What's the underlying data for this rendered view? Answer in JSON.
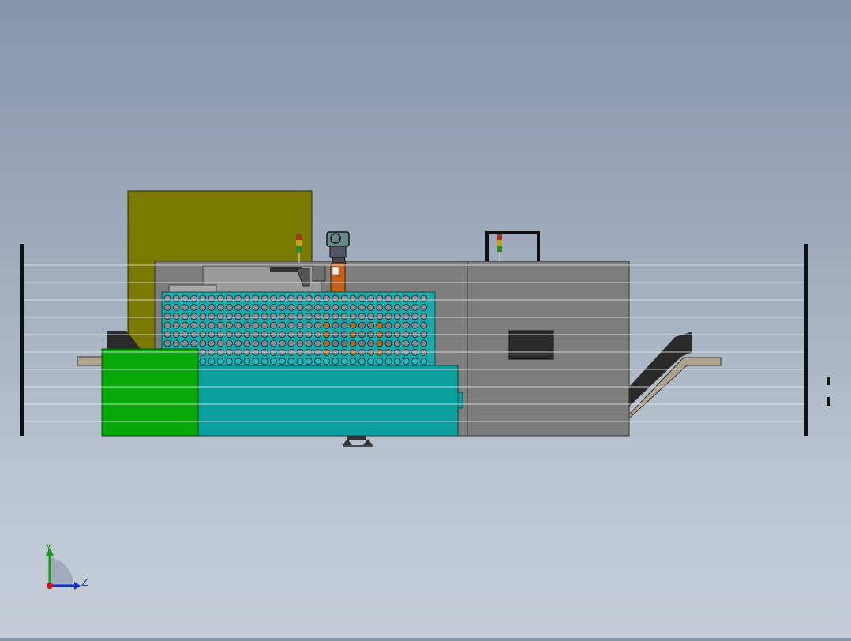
{
  "viewport": {
    "background_top": "#8795aa",
    "background_bottom": "#c6cdd8"
  },
  "model_colors": {
    "olive_cabinet": "#7a7a00",
    "gray_enclosure": "#787878",
    "teal_panel": "#0a9e9e",
    "green_block": "#08a808",
    "dark_chute": "#2a2a2a",
    "tan_rail": "#b0a38e",
    "orange_cylinder": "#c4621a"
  },
  "triad": {
    "x_color": "#d01010",
    "y_color": "#10a010",
    "z_color": "#1030d0",
    "y_label": "Y",
    "z_label": "Z"
  }
}
